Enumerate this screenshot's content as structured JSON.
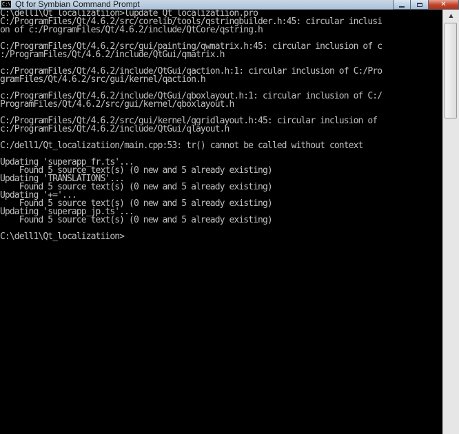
{
  "window": {
    "title": "Qt for Symbian Command Prompt",
    "icon_label": "C:\\"
  },
  "console": {
    "lines": [
      "C:\\dell1\\Qt_localizatiion>lupdate Qt_localizatiion.pro",
      "C:/ProgramFiles/Qt/4.6.2/src/corelib/tools/qstringbuilder.h:45: circular inclusi",
      "on of c:/ProgramFiles/Qt/4.6.2/include/QtCore/qstring.h",
      "",
      "C:/ProgramFiles/Qt/4.6.2/src/gui/painting/qwmatrix.h:45: circular inclusion of c",
      ":/ProgramFiles/Qt/4.6.2/include/QtGui/qmatrix.h",
      "",
      "c:/ProgramFiles/Qt/4.6.2/include/QtGui/qaction.h:1: circular inclusion of C:/Pro",
      "gramFiles/Qt/4.6.2/src/gui/kernel/qaction.h",
      "",
      "c:/ProgramFiles/Qt/4.6.2/include/QtGui/qboxlayout.h:1: circular inclusion of C:/",
      "ProgramFiles/Qt/4.6.2/src/gui/kernel/qboxlayout.h",
      "",
      "C:/ProgramFiles/Qt/4.6.2/src/gui/kernel/qgridlayout.h:45: circular inclusion of",
      "c:/ProgramFiles/Qt/4.6.2/include/QtGui/qlayout.h",
      "",
      "C:/dell1/Qt_localizatiion/main.cpp:53: tr() cannot be called without context",
      "",
      "Updating 'superapp_fr.ts'...",
      "    Found 5 source text(s) (0 new and 5 already existing)",
      "Updating 'TRANSLATIONS'...",
      "    Found 5 source text(s) (0 new and 5 already existing)",
      "Updating '+='...",
      "    Found 5 source text(s) (0 new and 5 already existing)",
      "Updating 'superapp_jp.ts'...",
      "    Found 5 source text(s) (0 new and 5 already existing)",
      "",
      "C:\\dell1\\Qt_localizatiion>"
    ]
  },
  "icons": {
    "minimize": "minimize-icon",
    "maximize": "maximize-icon",
    "close": "close-icon",
    "scroll_up": "scroll-up-arrow-icon"
  },
  "colors": {
    "console_background": "#000000",
    "console_text": "#c0c0c0",
    "close_button": "#c0442a"
  }
}
